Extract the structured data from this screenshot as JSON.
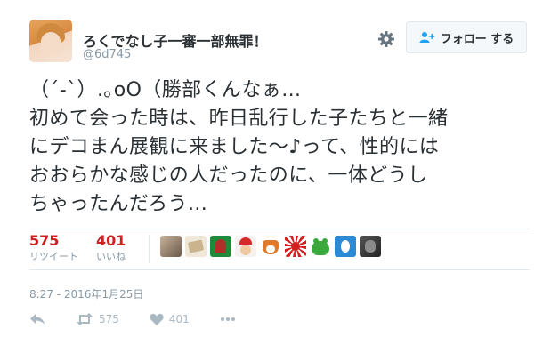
{
  "user": {
    "display_name": "ろくでなし子一審一部無罪！",
    "screen_name": "@6d745"
  },
  "header": {
    "follow_label": "フォロー する",
    "gear_icon": "gear-icon",
    "follow_icon": "person-add-icon"
  },
  "tweet": {
    "text": "（´-`）.｡oO（勝部くんなぁ…\n初めて会った時は、昨日乱行した子たちと一緒\nにデコまん展観に来ました〜♪って、性的には\nおおらかな感じの人だったのに、一体どうし\nちゃったんだろう…"
  },
  "stats": {
    "retweets": {
      "count": "575",
      "label": "リツイート"
    },
    "likes": {
      "count": "401",
      "label": "いいね"
    }
  },
  "liked_by": [
    "avatar-1",
    "avatar-2",
    "avatar-3",
    "avatar-4",
    "avatar-5",
    "avatar-6",
    "avatar-7",
    "avatar-8",
    "avatar-9"
  ],
  "timestamp": "8:27 - 2016年1月25日",
  "actions": {
    "reply_icon": "reply-icon",
    "retweet_icon": "retweet-icon",
    "retweet_count": "575",
    "like_icon": "heart-icon",
    "like_count": "401",
    "more_icon": "more-icon"
  },
  "colors": {
    "count_red": "#cc2222",
    "muted": "#8899a6",
    "border": "#e1e8ed",
    "text": "#292f33"
  }
}
